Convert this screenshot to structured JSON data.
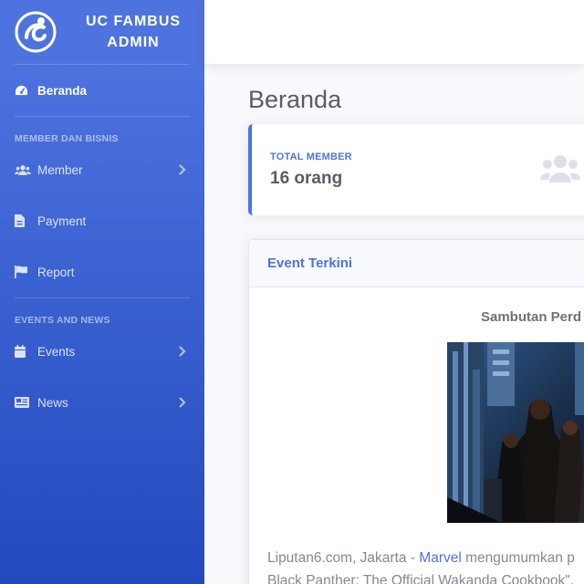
{
  "brand": {
    "line1": "UC FAMBUS",
    "line2": "ADMIN"
  },
  "sidebar": {
    "dashboard_label": "Beranda",
    "section_member_heading": "MEMBER DAN BISNIS",
    "member_label": "Member",
    "payment_label": "Payment",
    "report_label": "Report",
    "section_events_heading": "EVENTS AND NEWS",
    "events_label": "Events",
    "news_label": "News"
  },
  "main": {
    "page_title": "Beranda",
    "stat": {
      "label": "TOTAL MEMBER",
      "value": "16 orang"
    },
    "event": {
      "header": "Event Terkini",
      "subtitle": "Sambutan Perd",
      "text_prefix": "Liputan6.com, Jakarta - ",
      "text_link": "Marvel",
      "text_suffix": " mengumumkan p",
      "text_line2": "Black Panther: The Official Wakanda Cookbook\"."
    }
  },
  "icons": {
    "dashboard": "tachometer-icon",
    "member": "users-icon",
    "payment": "file-invoice-icon",
    "report": "flag-icon",
    "events": "calendar-icon",
    "news": "newspaper-icon",
    "stat": "users-icon"
  },
  "colors": {
    "primary": "#4e73df",
    "sidebar_bottom": "#224abe",
    "text_gray": "#5a5c69",
    "muted": "#858796"
  }
}
